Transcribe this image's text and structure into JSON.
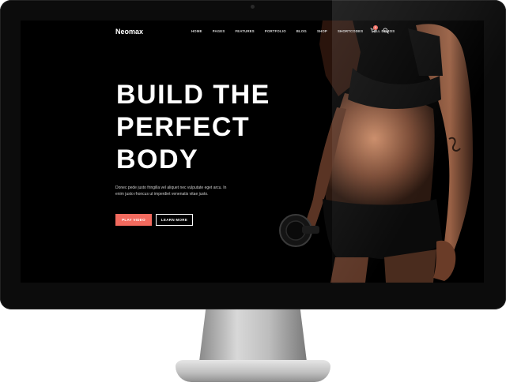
{
  "site": {
    "logo": "Neomax",
    "nav": [
      "HOME",
      "PAGES",
      "FEATURES",
      "PORTFOLIO",
      "BLOG",
      "SHOP",
      "SHORTCODES",
      "ALL DEMOS"
    ],
    "cart_count": "0"
  },
  "hero": {
    "title_lines": [
      "BUILD THE",
      "PERFECT",
      "BODY"
    ],
    "text_lines": [
      "Donec pede justo fringilla vel aliquet nec vulputate eget arcu. In",
      "enim justo rhoncus ut imperdiet venenatis vitae justo."
    ],
    "primary_button": "PLAY VIDEO",
    "secondary_button": "LEARN MORE"
  },
  "colors": {
    "accent": "#f26a5e",
    "screen_bg": "#000000",
    "monitor_bezel": "#0c0c0c"
  },
  "icons": [
    "cart-icon",
    "search-icon"
  ],
  "image": {
    "subject": "fitness-woman-with-dumbbell"
  }
}
